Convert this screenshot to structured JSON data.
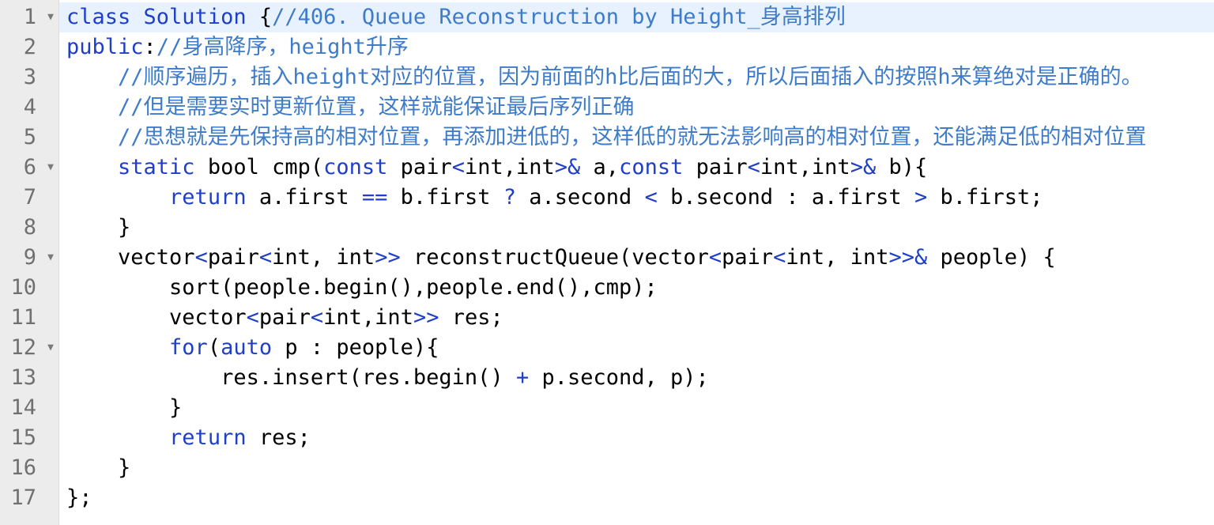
{
  "colors": {
    "keyword": "#1f3fc7",
    "comment": "#3e7bc8",
    "operator": "#1f3fc7",
    "text": "#000000",
    "gutter_bg": "#ececec",
    "line_number": "#707070",
    "active_line_bg": "#e8f2ff"
  },
  "lines": [
    {
      "num": "1",
      "fold": "▼",
      "indent": "",
      "tokens": [
        {
          "t": "class Solution ",
          "c": "keyword"
        },
        {
          "t": "{",
          "c": "text"
        },
        {
          "t": "//406. Queue Reconstruction by Height_身高排列",
          "c": "comment"
        }
      ]
    },
    {
      "num": "2",
      "fold": "",
      "indent": "",
      "tokens": [
        {
          "t": "public",
          "c": "keyword"
        },
        {
          "t": ":",
          "c": "text"
        },
        {
          "t": "//身高降序，height升序",
          "c": "comment"
        }
      ]
    },
    {
      "num": "3",
      "fold": "",
      "indent": "    ",
      "tokens": [
        {
          "t": "//顺序遍历，插入height对应的位置，因为前面的h比后面的大，所以后面插入的按照h来算绝对是正确的。",
          "c": "comment"
        }
      ]
    },
    {
      "num": "4",
      "fold": "",
      "indent": "    ",
      "tokens": [
        {
          "t": "//但是需要实时更新位置，这样就能保证最后序列正确",
          "c": "comment"
        }
      ]
    },
    {
      "num": "5",
      "fold": "",
      "indent": "    ",
      "tokens": [
        {
          "t": "//思想就是先保持高的相对位置，再添加进低的，这样低的就无法影响高的相对位置，还能满足低的相对位置",
          "c": "comment"
        }
      ]
    },
    {
      "num": "6",
      "fold": "▼",
      "indent": "    ",
      "tokens": [
        {
          "t": "static",
          "c": "keyword"
        },
        {
          "t": " bool cmp(",
          "c": "text"
        },
        {
          "t": "const",
          "c": "keyword"
        },
        {
          "t": " pair",
          "c": "text"
        },
        {
          "t": "<",
          "c": "operator"
        },
        {
          "t": "int,int",
          "c": "text"
        },
        {
          "t": ">&",
          "c": "operator"
        },
        {
          "t": " a,",
          "c": "text"
        },
        {
          "t": "const",
          "c": "keyword"
        },
        {
          "t": " pair",
          "c": "text"
        },
        {
          "t": "<",
          "c": "operator"
        },
        {
          "t": "int,int",
          "c": "text"
        },
        {
          "t": ">&",
          "c": "operator"
        },
        {
          "t": " b){",
          "c": "text"
        }
      ]
    },
    {
      "num": "7",
      "fold": "",
      "indent": "        ",
      "tokens": [
        {
          "t": "return",
          "c": "keyword"
        },
        {
          "t": " a.first ",
          "c": "text"
        },
        {
          "t": "==",
          "c": "operator"
        },
        {
          "t": " b.first ",
          "c": "text"
        },
        {
          "t": "?",
          "c": "operator"
        },
        {
          "t": " a.second ",
          "c": "text"
        },
        {
          "t": "<",
          "c": "operator"
        },
        {
          "t": " b.second : a.first ",
          "c": "text"
        },
        {
          "t": ">",
          "c": "operator"
        },
        {
          "t": " b.first;",
          "c": "text"
        }
      ]
    },
    {
      "num": "8",
      "fold": "",
      "indent": "    ",
      "tokens": [
        {
          "t": "}",
          "c": "text"
        }
      ]
    },
    {
      "num": "9",
      "fold": "▼",
      "indent": "    ",
      "tokens": [
        {
          "t": "vector",
          "c": "text"
        },
        {
          "t": "<",
          "c": "operator"
        },
        {
          "t": "pair",
          "c": "text"
        },
        {
          "t": "<",
          "c": "operator"
        },
        {
          "t": "int, int",
          "c": "text"
        },
        {
          "t": ">>",
          "c": "operator"
        },
        {
          "t": " reconstructQueue(vector",
          "c": "text"
        },
        {
          "t": "<",
          "c": "operator"
        },
        {
          "t": "pair",
          "c": "text"
        },
        {
          "t": "<",
          "c": "operator"
        },
        {
          "t": "int, int",
          "c": "text"
        },
        {
          "t": ">>&",
          "c": "operator"
        },
        {
          "t": " people) {",
          "c": "text"
        }
      ]
    },
    {
      "num": "10",
      "fold": "",
      "indent": "        ",
      "tokens": [
        {
          "t": "sort(people.begin(),people.end(),cmp);",
          "c": "text"
        }
      ]
    },
    {
      "num": "11",
      "fold": "",
      "indent": "        ",
      "tokens": [
        {
          "t": "vector",
          "c": "text"
        },
        {
          "t": "<",
          "c": "operator"
        },
        {
          "t": "pair",
          "c": "text"
        },
        {
          "t": "<",
          "c": "operator"
        },
        {
          "t": "int,int",
          "c": "text"
        },
        {
          "t": ">>",
          "c": "operator"
        },
        {
          "t": " res;",
          "c": "text"
        }
      ]
    },
    {
      "num": "12",
      "fold": "▼",
      "indent": "        ",
      "tokens": [
        {
          "t": "for",
          "c": "keyword"
        },
        {
          "t": "(",
          "c": "text"
        },
        {
          "t": "auto",
          "c": "keyword"
        },
        {
          "t": " p : people){",
          "c": "text"
        }
      ]
    },
    {
      "num": "13",
      "fold": "",
      "indent": "            ",
      "tokens": [
        {
          "t": "res.insert(res.begin() ",
          "c": "text"
        },
        {
          "t": "+",
          "c": "operator"
        },
        {
          "t": " p.second, p);",
          "c": "text"
        }
      ]
    },
    {
      "num": "14",
      "fold": "",
      "indent": "        ",
      "tokens": [
        {
          "t": "}",
          "c": "text"
        }
      ]
    },
    {
      "num": "15",
      "fold": "",
      "indent": "        ",
      "tokens": [
        {
          "t": "return",
          "c": "keyword"
        },
        {
          "t": " res;",
          "c": "text"
        }
      ]
    },
    {
      "num": "16",
      "fold": "",
      "indent": "    ",
      "tokens": [
        {
          "t": "}",
          "c": "text"
        }
      ]
    },
    {
      "num": "17",
      "fold": "",
      "indent": "",
      "tokens": [
        {
          "t": "};",
          "c": "text"
        }
      ]
    }
  ]
}
